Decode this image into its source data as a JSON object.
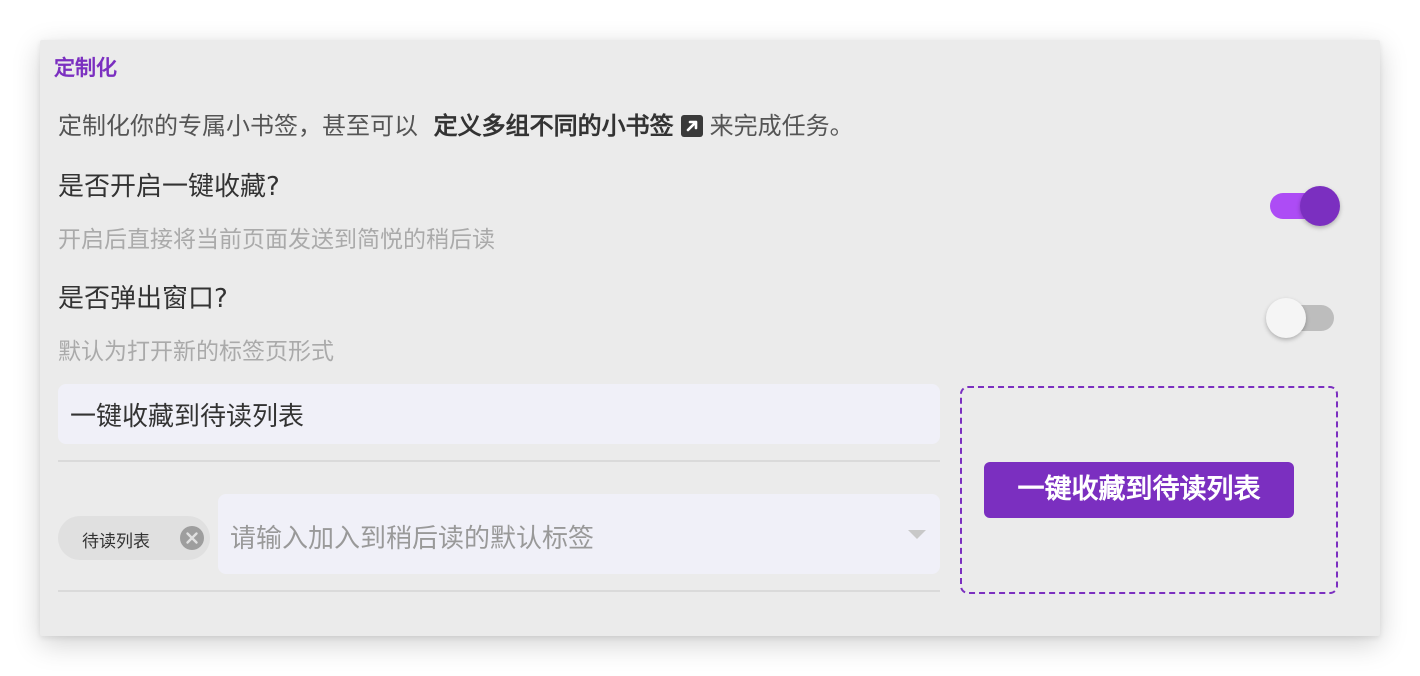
{
  "section": {
    "title": "定制化",
    "description_prefix": "定制化你的专属小书签，甚至可以",
    "description_link": "定义多组不同的小书签",
    "description_suffix": "来完成任务。"
  },
  "options": [
    {
      "label": "是否开启一键收藏?",
      "hint": "开启后直接将当前页面发送到简悦的稍后读",
      "enabled": true
    },
    {
      "label": "是否弹出窗口?",
      "hint": "默认为打开新的标签页形式",
      "enabled": false
    }
  ],
  "name_input": {
    "value": "一键收藏到待读列表"
  },
  "tags": {
    "chips": [
      "待读列表"
    ],
    "placeholder": "请输入加入到稍后读的默认标签"
  },
  "preview": {
    "button_label": "一键收藏到待读列表"
  },
  "colors": {
    "accent": "#7b2fc0",
    "accent_light": "#ad4cf5",
    "card_bg": "#ebebeb",
    "input_bg": "#f0f0f8"
  },
  "icons": {
    "external_link": "external-link-icon",
    "chip_remove": "close-circle-icon",
    "select_arrow": "caret-down-icon"
  }
}
